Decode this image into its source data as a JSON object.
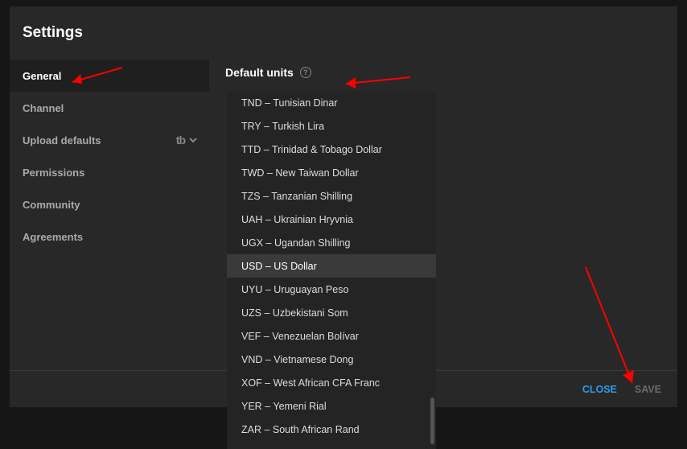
{
  "title": "Settings",
  "sidebar": {
    "items": [
      {
        "label": "General",
        "active": true
      },
      {
        "label": "Channel",
        "active": false
      },
      {
        "label": "Upload defaults",
        "active": false,
        "has_tb_icon": true
      },
      {
        "label": "Permissions",
        "active": false
      },
      {
        "label": "Community",
        "active": false
      },
      {
        "label": "Agreements",
        "active": false
      }
    ]
  },
  "main": {
    "section_title": "Default units",
    "currency_options": [
      {
        "label": "TND – Tunisian Dinar",
        "selected": false
      },
      {
        "label": "TRY – Turkish Lira",
        "selected": false
      },
      {
        "label": "TTD – Trinidad & Tobago Dollar",
        "selected": false
      },
      {
        "label": "TWD – New Taiwan Dollar",
        "selected": false
      },
      {
        "label": "TZS – Tanzanian Shilling",
        "selected": false
      },
      {
        "label": "UAH – Ukrainian Hryvnia",
        "selected": false
      },
      {
        "label": "UGX – Ugandan Shilling",
        "selected": false
      },
      {
        "label": "USD – US Dollar",
        "selected": true
      },
      {
        "label": "UYU – Uruguayan Peso",
        "selected": false
      },
      {
        "label": "UZS – Uzbekistani Som",
        "selected": false
      },
      {
        "label": "VEF – Venezuelan Bolívar",
        "selected": false
      },
      {
        "label": "VND – Vietnamese Dong",
        "selected": false
      },
      {
        "label": "XOF – West African CFA Franc",
        "selected": false
      },
      {
        "label": "YER – Yemeni Rial",
        "selected": false
      },
      {
        "label": "ZAR – South African Rand",
        "selected": false
      }
    ]
  },
  "footer": {
    "close_label": "CLOSE",
    "save_label": "SAVE"
  },
  "accent_blue": "#2f99e8",
  "arrow_color": "#ff0000"
}
